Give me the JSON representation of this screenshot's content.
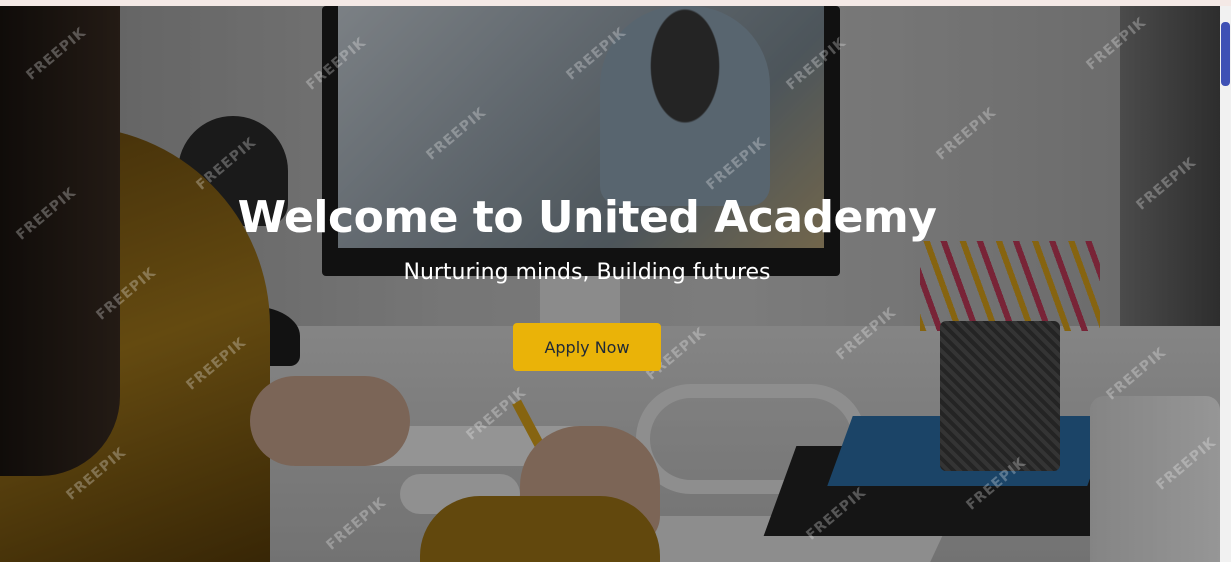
{
  "hero": {
    "title": "Welcome to United Academy",
    "subtitle": "Nurturing minds, Building futures",
    "cta_label": "Apply Now",
    "watermark_text": "FREEPIK"
  },
  "colors": {
    "cta_background": "#eab308",
    "cta_text": "#1f2937",
    "scrollbar_thumb": "#3f51b5",
    "top_strip": "#f4e9e6"
  }
}
